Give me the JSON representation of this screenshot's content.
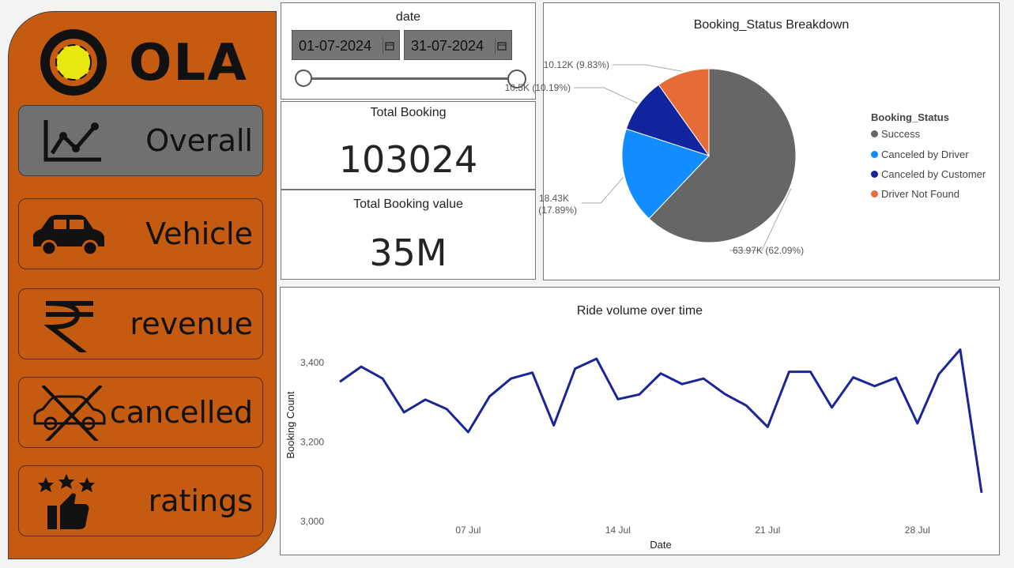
{
  "sidebar": {
    "logo_text": "OLA",
    "items": [
      {
        "label": "Overall",
        "icon": "line-chart-icon",
        "active": true
      },
      {
        "label": "Vehicle",
        "icon": "car-icon",
        "active": false
      },
      {
        "label": "revenue",
        "icon": "rupee-icon",
        "active": false
      },
      {
        "label": "cancelled",
        "icon": "cancelled-car-icon",
        "active": false
      },
      {
        "label": "ratings",
        "icon": "stars-thumbs-up-icon",
        "active": false
      }
    ]
  },
  "date_slicer": {
    "title": "date",
    "start": "01-07-2024",
    "end": "31-07-2024",
    "slider_range": [
      0,
      1
    ]
  },
  "kpis": {
    "total_booking": {
      "title": "Total Booking",
      "value": "103024"
    },
    "total_booking_value": {
      "title": "Total Booking value",
      "value": "35M"
    }
  },
  "colors": {
    "sidebar": "#c55a11",
    "active_button": "#707070",
    "line": "#1a2596",
    "success": "#666666",
    "canceled_driver": "#118dff",
    "canceled_customer": "#12239e",
    "driver_not_found": "#e66c37"
  },
  "chart_data": [
    {
      "type": "pie",
      "title": "Booking_Status Breakdown",
      "legend_title": "Booking_Status",
      "legend_position": "right",
      "slices": [
        {
          "name": "Success",
          "value": 63970,
          "label": "63.97K (62.09%)",
          "color": "#666666"
        },
        {
          "name": "Canceled by Driver",
          "value": 18430,
          "label": "18.43K (17.89%)",
          "color": "#118dff"
        },
        {
          "name": "Canceled by Customer",
          "value": 10500,
          "label": "10.5K (10.19%)",
          "color": "#12239e"
        },
        {
          "name": "Driver Not Found",
          "value": 10120,
          "label": "10.12K (9.83%)",
          "color": "#e66c37"
        }
      ]
    },
    {
      "type": "line",
      "title": "Ride volume over time",
      "xlabel": "Date",
      "ylabel": "Booking Count",
      "ylim": [
        3000,
        3450
      ],
      "yticks": [
        3000,
        3200,
        3400
      ],
      "ytick_labels": [
        "3,000",
        "3,200",
        "3,400"
      ],
      "xlim": [
        1,
        31
      ],
      "xticks": [
        7,
        14,
        21,
        28
      ],
      "xtick_labels": [
        "07 Jul",
        "14 Jul",
        "21 Jul",
        "28 Jul"
      ],
      "grid": false,
      "x": [
        1,
        2,
        3,
        4,
        5,
        6,
        7,
        8,
        9,
        10,
        11,
        12,
        13,
        14,
        15,
        16,
        17,
        18,
        19,
        20,
        21,
        22,
        23,
        24,
        25,
        26,
        27,
        28,
        29,
        30,
        31
      ],
      "values": [
        3352,
        3390,
        3360,
        3275,
        3307,
        3283,
        3225,
        3315,
        3360,
        3375,
        3242,
        3385,
        3410,
        3308,
        3320,
        3373,
        3346,
        3360,
        3321,
        3292,
        3238,
        3377,
        3377,
        3287,
        3363,
        3341,
        3362,
        3247,
        3371,
        3433,
        3072
      ]
    }
  ]
}
